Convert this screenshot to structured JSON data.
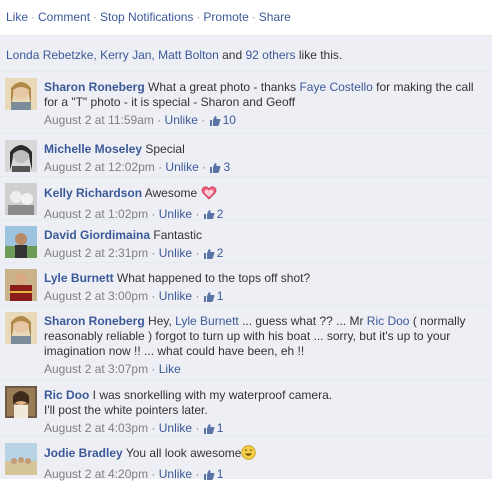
{
  "actions": [
    "Like",
    "Comment",
    "Stop Notifications",
    "Promote",
    "Share"
  ],
  "likes_summary": {
    "names": "Londa Rebetzke, Kerry Jan, Matt Bolton",
    "middle": " and ",
    "others": "92 others",
    "suffix": " like this."
  },
  "comments": [
    {
      "author": "Sharon Roneberg",
      "text_before": " What a great photo - thanks ",
      "mention": "Faye Costello",
      "text_after": " for making the call for a \"T\" photo - it is special - Sharon and Geoff",
      "time": "August 2 at 11:59am",
      "action": "Unlike",
      "likes": "10"
    },
    {
      "author": "Michelle Moseley",
      "text": " Special",
      "time": "August 2 at 12:02pm",
      "action": "Unlike",
      "likes": "3"
    },
    {
      "author": "Kelly Richardson",
      "text": " Awesome ",
      "time": "August 2 at 1:02pm",
      "action": "Unlike",
      "likes": "2"
    },
    {
      "author": "David Giordimaina",
      "text": " Fantastic",
      "time": "August 2 at 2:31pm",
      "action": "Unlike",
      "likes": "2"
    },
    {
      "author": "Lyle Burnett",
      "text": " What happened to the tops off shot?",
      "time": "August 2 at 3:00pm",
      "action": "Unlike",
      "likes": "1"
    },
    {
      "author": "Sharon Roneberg",
      "text_before": " Hey, ",
      "mention": "Lyle Burnett",
      "text_mid": " ... guess what ?? ... Mr ",
      "mention2": "Ric Doo",
      "text_after": " ( normally reasonably reliable ) forgot to turn up with his boat ... sorry, but it's up to your imagination now !! ... what could have been, eh !!",
      "time": "August 2 at 3:07pm",
      "action": "Like"
    },
    {
      "author": "Ric Doo",
      "text": " I was snorkelling with my waterproof camera.",
      "text2": "I'll post the white pointers later.",
      "time": "August 2 at 4:03pm",
      "action": "Unlike",
      "likes": "1"
    },
    {
      "author": "Jodie Bradley",
      "text": " You all look awesome",
      "time": "August 2 at 4:20pm",
      "action": "Unlike",
      "likes": "1"
    }
  ],
  "sep": " · ",
  "colors": {
    "link": "#3b5998",
    "meta": "#808080",
    "bg": "#edeff4"
  }
}
